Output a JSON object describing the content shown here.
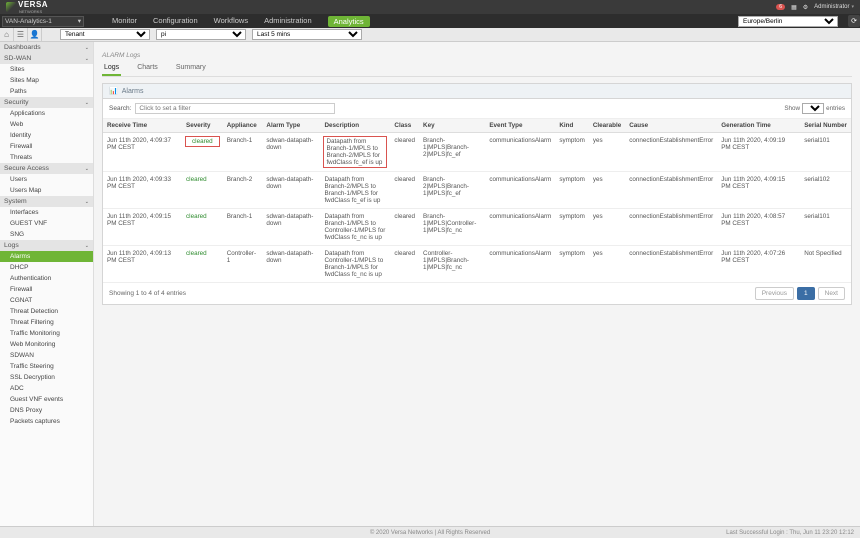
{
  "brand": {
    "name": "VERSA",
    "sub": "NETWORKS"
  },
  "topbar": {
    "notifications_badge": "6",
    "user_label": "Administrator"
  },
  "tenant_selector": "VAN-Analytics-1",
  "main_tabs": [
    "Monitor",
    "Configuration",
    "Workflows",
    "Administration",
    "Analytics"
  ],
  "main_tab_active_index": 4,
  "timezone_select": "Europe/Berlin",
  "filters": {
    "tenant": "Tenant",
    "pi": "pi",
    "range": "Last 5 mins"
  },
  "sidebar": {
    "groups": [
      {
        "label": "Dashboards",
        "items": []
      },
      {
        "label": "SD-WAN",
        "items": [
          "Sites",
          "Sites Map",
          "Paths"
        ]
      },
      {
        "label": "Security",
        "items": [
          "Applications",
          "Web",
          "Identity",
          "Firewall",
          "Threats"
        ]
      },
      {
        "label": "Secure Access",
        "items": [
          "Users",
          "Users Map"
        ]
      },
      {
        "label": "System",
        "items": [
          "Interfaces",
          "GUEST VNF",
          "SNG"
        ]
      },
      {
        "label": "Logs",
        "items": [
          "Alarms",
          "DHCP",
          "Authentication",
          "Firewall",
          "CGNAT",
          "Threat Detection",
          "Threat Filtering",
          "Traffic Monitoring",
          "Web Monitoring",
          "SDWAN",
          "Traffic Steering",
          "SSL Decryption",
          "ADC",
          "Guest VNF events",
          "DNS Proxy",
          "Packets captures"
        ]
      }
    ],
    "active": "Alarms"
  },
  "content": {
    "breadcrumb": "ALARM Logs",
    "tabs": [
      "Logs",
      "Charts",
      "Summary"
    ],
    "active_tab_index": 0,
    "panel_title": "Alarms",
    "search_label": "Search:",
    "search_placeholder": "Click to set a filter",
    "show_prefix": "Show",
    "entries_suffix": "entries",
    "columns": [
      "Receive Time",
      "Severity",
      "Appliance",
      "Alarm Type",
      "Description",
      "Class",
      "Key",
      "Event Type",
      "Kind",
      "Clearable",
      "Cause",
      "Generation Time",
      "Serial Number"
    ],
    "rows": [
      {
        "receive_time": "Jun 11th 2020, 4:09:37 PM CEST",
        "severity": "cleared",
        "appliance": "Branch-1",
        "alarm_type": "sdwan-datapath-down",
        "description": "Datapath from Branch-1/MPLS to Branch-2/MPLS for fwdClass fc_ef is up",
        "class": "cleared",
        "key": "Branch-1|MPLS|Branch-2|MPLS|fc_ef",
        "event_type": "communicationsAlarm",
        "kind": "symptom",
        "clearable": "yes",
        "cause": "connectionEstablishmentError",
        "gen_time": "Jun 11th 2020, 4:09:19 PM CEST",
        "serial": "serial101",
        "highlight": true
      },
      {
        "receive_time": "Jun 11th 2020, 4:09:33 PM CEST",
        "severity": "cleared",
        "appliance": "Branch-2",
        "alarm_type": "sdwan-datapath-down",
        "description": "Datapath from Branch-2/MPLS to Branch-1/MPLS for fwdClass fc_ef is up",
        "class": "cleared",
        "key": "Branch-2|MPLS|Branch-1|MPLS|fc_ef",
        "event_type": "communicationsAlarm",
        "kind": "symptom",
        "clearable": "yes",
        "cause": "connectionEstablishmentError",
        "gen_time": "Jun 11th 2020, 4:09:15 PM CEST",
        "serial": "serial102",
        "highlight": false
      },
      {
        "receive_time": "Jun 11th 2020, 4:09:15 PM CEST",
        "severity": "cleared",
        "appliance": "Branch-1",
        "alarm_type": "sdwan-datapath-down",
        "description": "Datapath from Branch-1/MPLS to Controller-1/MPLS for fwdClass fc_nc is up",
        "class": "cleared",
        "key": "Branch-1|MPLS|Controller-1|MPLS|fc_nc",
        "event_type": "communicationsAlarm",
        "kind": "symptom",
        "clearable": "yes",
        "cause": "connectionEstablishmentError",
        "gen_time": "Jun 11th 2020, 4:08:57 PM CEST",
        "serial": "serial101",
        "highlight": false
      },
      {
        "receive_time": "Jun 11th 2020, 4:09:13 PM CEST",
        "severity": "cleared",
        "appliance": "Controller-1",
        "alarm_type": "sdwan-datapath-down",
        "description": "Datapath from Controller-1/MPLS to Branch-1/MPLS for fwdClass fc_nc is up",
        "class": "cleared",
        "key": "Controller-1|MPLS|Branch-1|MPLS|fc_nc",
        "event_type": "communicationsAlarm",
        "kind": "symptom",
        "clearable": "yes",
        "cause": "connectionEstablishmentError",
        "gen_time": "Jun 11th 2020, 4:07:26 PM CEST",
        "serial": "Not Specified",
        "highlight": false
      }
    ],
    "pager_info": "Showing 1 to 4 of 4 entries",
    "pager_prev": "Previous",
    "pager_next": "Next",
    "pager_current": "1"
  },
  "footer": {
    "center": "© 2020 Versa Networks | All Rights Reserved",
    "right": "Last Successful Login : Thu, Jun 11 23:20 12:12"
  }
}
